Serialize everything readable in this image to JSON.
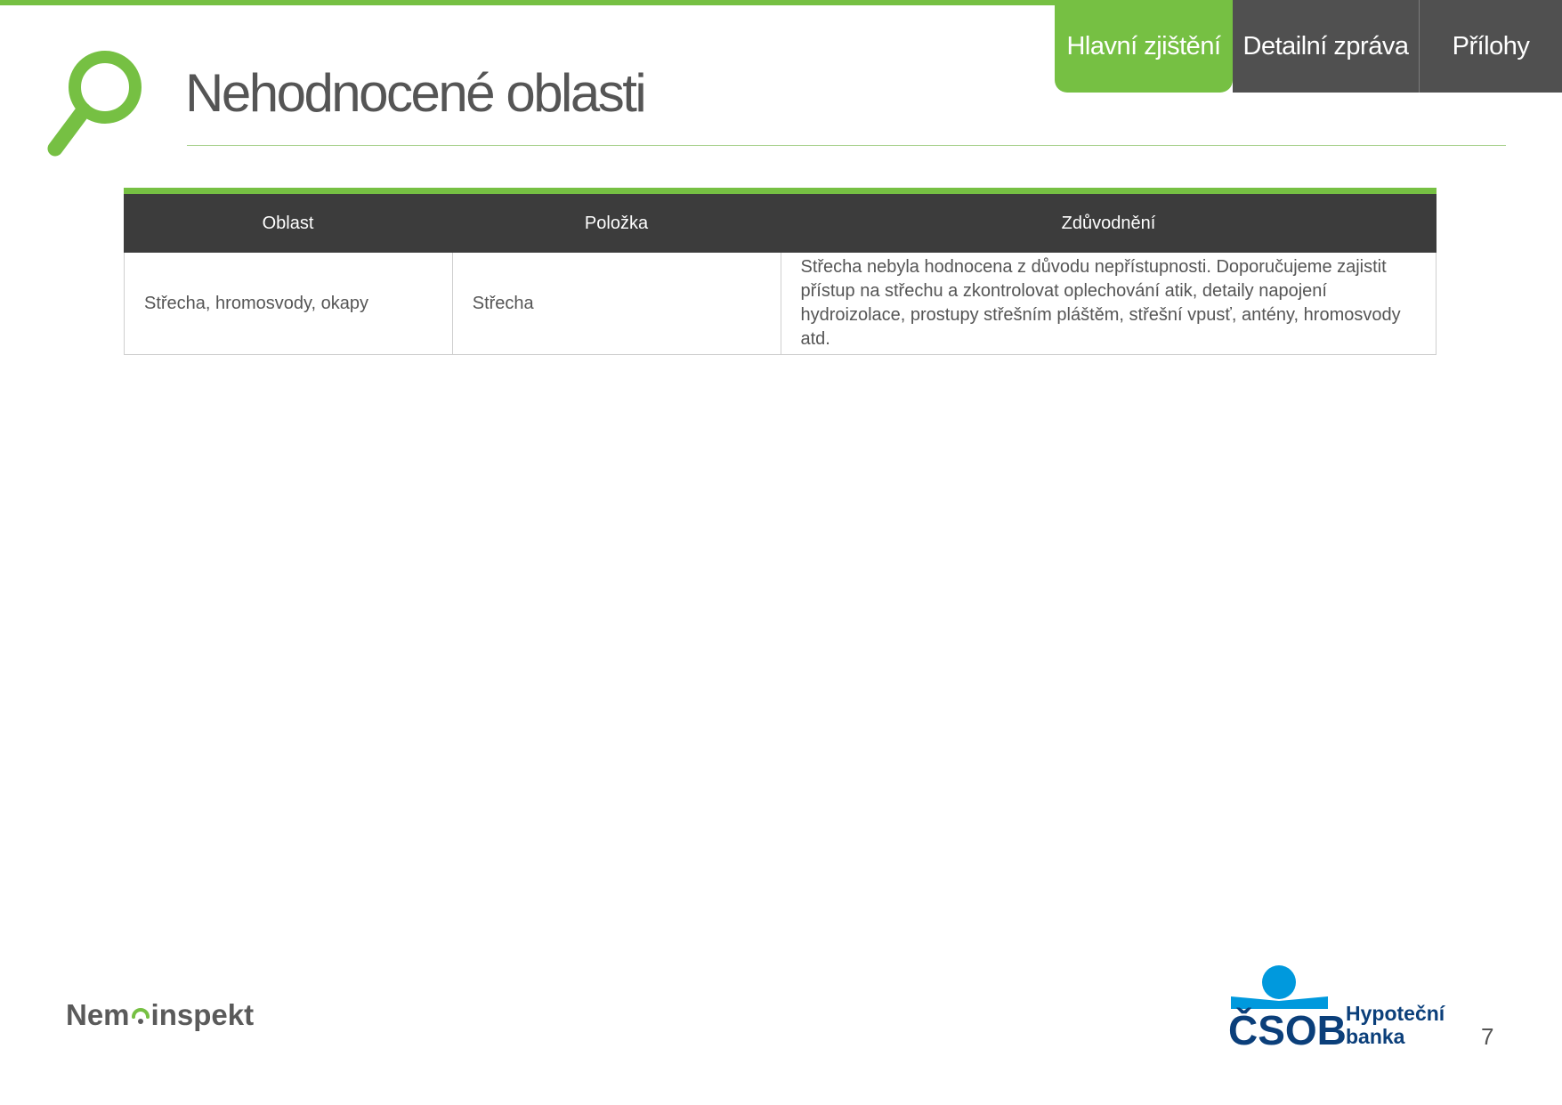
{
  "tabs": [
    {
      "label": "Hlavní zjištění",
      "active": true
    },
    {
      "label": "Detailní zpráva",
      "active": false
    },
    {
      "label": "Přílohy",
      "active": false
    }
  ],
  "page_title": "Nehodnocené oblasti",
  "table": {
    "headers": [
      "Oblast",
      "Položka",
      "Zdůvodnění"
    ],
    "rows": [
      {
        "oblast": "Střecha, hromosvody, okapy",
        "polozka": "Střecha",
        "zduvodneni": "Střecha nebyla hodnocena z důvodu nepřístupnosti. Doporučujeme zajistit přístup na střechu a zkontrolovat oplechování atik, detaily napojení hydroizolace, prostupy střešním pláštěm, střešní vpusť, antény, hromosvody atd."
      }
    ]
  },
  "footer": {
    "brand_left_a": "Nem",
    "brand_left_b": "inspekt",
    "brand_right_mark": "ČSOB",
    "brand_right_line1": "Hypoteční",
    "brand_right_line2": "banka",
    "page_number": "7"
  },
  "colors": {
    "accent_green": "#76c043",
    "dark": "#3c3c3c",
    "csob_blue": "#0b3f7a",
    "csob_light_blue": "#0099dd"
  },
  "icons": [
    "magnifier-icon"
  ]
}
